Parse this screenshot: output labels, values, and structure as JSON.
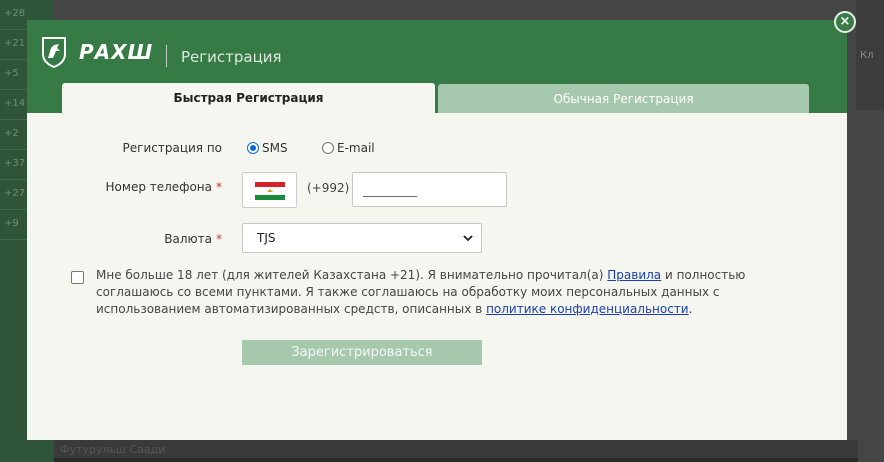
{
  "background": {
    "left_rows": [
      "+28",
      "+21",
      "+5",
      "+14",
      "+2",
      "+37",
      "+27",
      "+9"
    ],
    "right_text": "Кл",
    "bottom_text": "Футурульш Саади"
  },
  "modal": {
    "brand": "РАХШ",
    "title": "Регистрация",
    "tabs": {
      "fast": "Быстрая Регистрация",
      "normal": "Обычная Регистрация"
    },
    "close_label": "×"
  },
  "form": {
    "reg_by_label": "Регистрация по",
    "options": {
      "sms": "SMS",
      "email": "E-mail"
    },
    "selected_option": "sms",
    "phone_label": "Номер телефона",
    "required_mark": "*",
    "phone_code": "(+992)",
    "phone_placeholder": "_________",
    "currency_label": "Валюта",
    "currency_value": "TJS",
    "agree_before": "Мне больше 18 лет (для жителей Казахстана +21). Я внимательно прочитал(а) ",
    "agree_link1": "Правила",
    "agree_middle": " и полностью соглашаюсь со всеми пунктами. Я также соглашаюсь на обработку моих персональных данных с использованием автоматизированных средств, описанных в ",
    "agree_link2": "политике конфиденциальности",
    "agree_after": ".",
    "submit_label": "Зарегистрироваться"
  },
  "colors": {
    "header_green": "#367a45",
    "tab_inactive": "#a6c9ae",
    "required_red": "#d0342c",
    "link_blue": "#1a3fb4"
  }
}
